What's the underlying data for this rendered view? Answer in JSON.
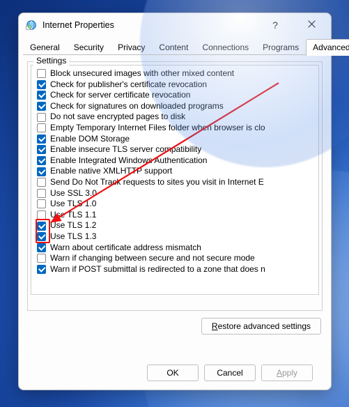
{
  "window": {
    "title": "Internet Properties",
    "help_label": "?",
    "close_label": "✕"
  },
  "tabs": [
    {
      "label": "General",
      "active": false
    },
    {
      "label": "Security",
      "active": false
    },
    {
      "label": "Privacy",
      "active": false
    },
    {
      "label": "Content",
      "active": false
    },
    {
      "label": "Connections",
      "active": false
    },
    {
      "label": "Programs",
      "active": false
    },
    {
      "label": "Advanced",
      "active": true
    }
  ],
  "settings": {
    "legend": "Settings",
    "items": [
      {
        "checked": false,
        "label": "Block unsecured images with other mixed content"
      },
      {
        "checked": true,
        "label": "Check for publisher's certificate revocation"
      },
      {
        "checked": true,
        "label": "Check for server certificate revocation"
      },
      {
        "checked": true,
        "label": "Check for signatures on downloaded programs"
      },
      {
        "checked": false,
        "label": "Do not save encrypted pages to disk"
      },
      {
        "checked": false,
        "label": "Empty Temporary Internet Files folder when browser is clo"
      },
      {
        "checked": true,
        "label": "Enable DOM Storage"
      },
      {
        "checked": true,
        "label": "Enable insecure TLS server compatibility"
      },
      {
        "checked": true,
        "label": "Enable Integrated Windows Authentication"
      },
      {
        "checked": true,
        "label": "Enable native XMLHTTP support"
      },
      {
        "checked": false,
        "label": "Send Do Not Track requests to sites you visit in Internet E"
      },
      {
        "checked": false,
        "label": "Use SSL 3.0"
      },
      {
        "checked": false,
        "label": "Use TLS 1.0"
      },
      {
        "checked": false,
        "label": "Use TLS 1.1"
      },
      {
        "checked": true,
        "label": "Use TLS 1.2"
      },
      {
        "checked": true,
        "label": "Use TLS 1.3"
      },
      {
        "checked": true,
        "label": "Warn about certificate address mismatch"
      },
      {
        "checked": false,
        "label": "Warn if changing between secure and not secure mode"
      },
      {
        "checked": true,
        "label": "Warn if POST submittal is redirected to a zone that does n"
      }
    ]
  },
  "buttons": {
    "restore": "Restore advanced settings",
    "ok": "OK",
    "cancel": "Cancel",
    "apply": "Apply"
  },
  "annotation": {
    "highlight_start_index": 14,
    "highlight_end_index": 15,
    "arrow_color": "#e11"
  }
}
